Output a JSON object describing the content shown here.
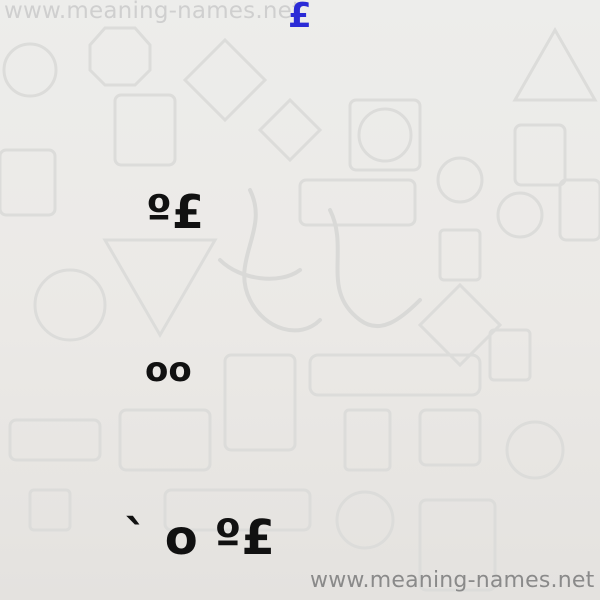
{
  "watermark_top": "www.meaning-names.net",
  "watermark_bottom": "www.meaning-names.net",
  "pound_symbol": "£",
  "lines": [
    "º£",
    "oo",
    "` o º£"
  ],
  "background_icons": [
    "road-sign-icon",
    "one-way-sign-icon",
    "no-u-turn-sign-icon",
    "no-parking-sign-icon",
    "road-closed-sign-icon",
    "speed-limit-sign-icon",
    "railroad-crossing-sign-icon",
    "construction-sign-icon"
  ],
  "colors": {
    "background": "#ebe9e6",
    "text": "#111111",
    "accent": "#2b2bd6",
    "watermark": "#8a8a8a"
  }
}
